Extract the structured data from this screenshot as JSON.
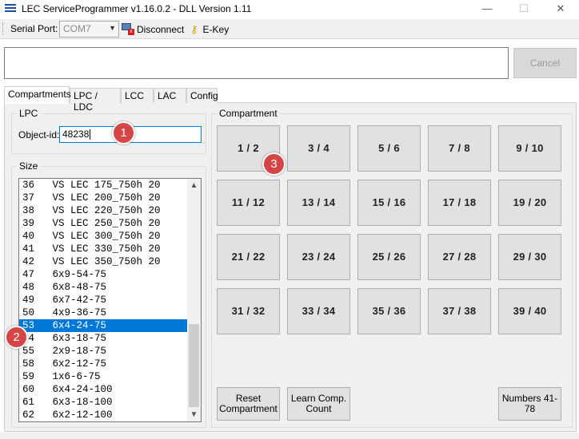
{
  "window": {
    "title": "LEC ServiceProgrammer v1.16.0.2 - DLL Version 1.11",
    "minimize_glyph": "—",
    "maximize_glyph": "☐",
    "close_glyph": "✕"
  },
  "toolbar": {
    "serial_port_label": "Serial Port:",
    "serial_port_value": "COM7",
    "disconnect_label": "Disconnect",
    "ekey_label": "E-Key"
  },
  "log": {
    "cancel_label": "Cancel"
  },
  "tabs": [
    {
      "label": "Compartments",
      "active": true
    },
    {
      "label": "LPC / LDC",
      "active": false
    },
    {
      "label": "LCC",
      "active": false
    },
    {
      "label": "LAC",
      "active": false
    },
    {
      "label": "Config",
      "active": false
    }
  ],
  "lpc": {
    "group_title": "LPC",
    "object_id_label": "Object-id:",
    "object_id_value": "48238"
  },
  "size": {
    "group_title": "Size",
    "selected_index": 11,
    "items": [
      "36   VS LEC 175_750h 20",
      "37   VS LEC 200_750h 20",
      "38   VS LEC 220_750h 20",
      "39   VS LEC 250_750h 20",
      "40   VS LEC 300_750h 20",
      "41   VS LEC 330_750h 20",
      "42   VS LEC 350_750h 20",
      "47   6x9-54-75",
      "48   6x8-48-75",
      "49   6x7-42-75",
      "50   4x9-36-75",
      "53   6x4-24-75",
      "54   6x3-18-75",
      "55   2x9-18-75",
      "58   6x2-12-75",
      "59   1x6-6-75",
      "60   6x4-24-100",
      "61   6x3-18-100",
      "62   6x2-12-100"
    ]
  },
  "compartment": {
    "group_title": "Compartment",
    "buttons": [
      "1 / 2",
      "3 / 4",
      "5 / 6",
      "7 / 8",
      "9 / 10",
      "11 / 12",
      "13 / 14",
      "15 / 16",
      "17 / 18",
      "19 / 20",
      "21 / 22",
      "23 / 24",
      "25 / 26",
      "27 / 28",
      "29 / 30",
      "31 / 32",
      "33 / 34",
      "35 / 36",
      "37 / 38",
      "39 / 40"
    ],
    "reset_label": "Reset Compartment",
    "learn_label": "Learn Comp. Count",
    "numbers_label": "Numbers 41-78"
  },
  "annotations": {
    "badge1": "1",
    "badge2": "2",
    "badge3": "3"
  },
  "colors": {
    "selection": "#0078d7",
    "badge": "#d64545"
  }
}
